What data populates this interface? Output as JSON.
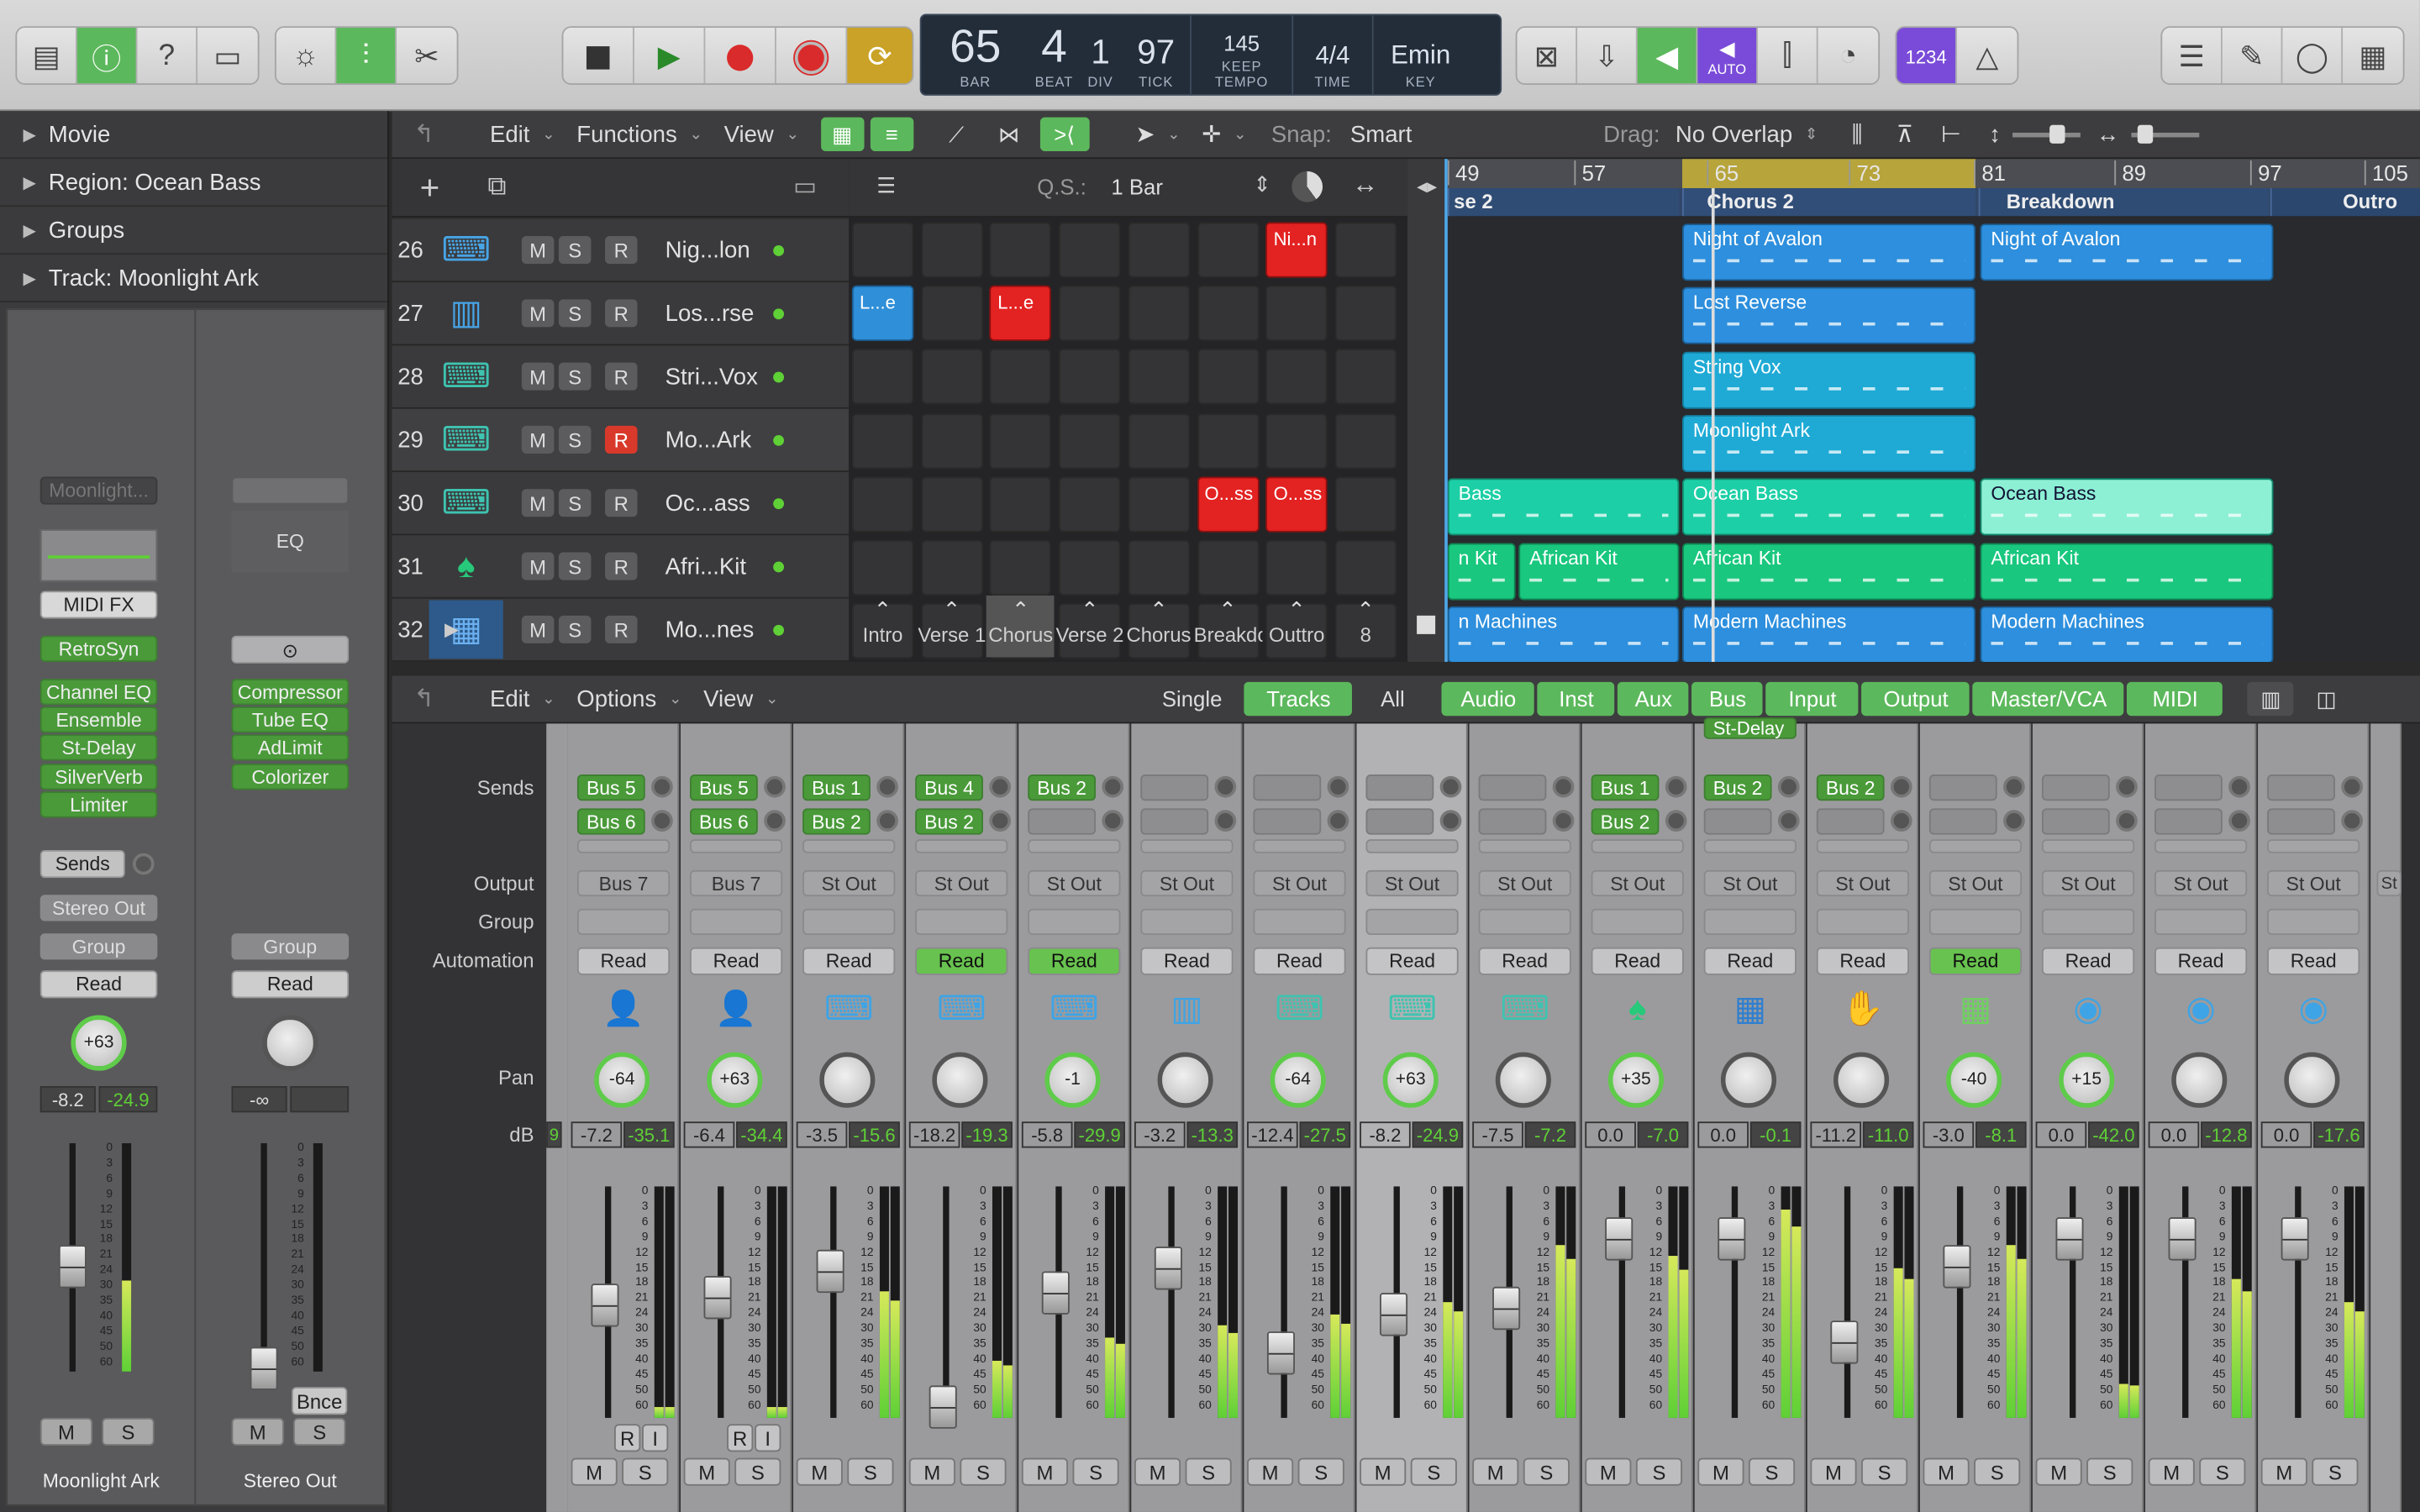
{
  "toolbar": {
    "lcd": {
      "bar": "65",
      "beat": "4",
      "div": "1",
      "tick": "97",
      "tempo": "145",
      "tempo_mode": "KEEP",
      "signature": "4/4",
      "key": "Emin",
      "bar_label": "BAR",
      "beat_label": "BEAT",
      "div_label": "DIV",
      "tick_label": "TICK",
      "tempo_label": "TEMPO",
      "time_label": "TIME",
      "key_label": "KEY"
    },
    "auto_label": "AUTO",
    "count_label": "1234"
  },
  "inspector": {
    "rows": [
      "Movie",
      "Region: Ocean Bass",
      "Groups",
      "Track: Moonlight Ark"
    ],
    "strip1": {
      "setting": "Moonlight...",
      "midi_fx": "MIDI FX",
      "instrument": "RetroSyn",
      "plugins": [
        "Channel EQ",
        "Ensemble",
        "St-Delay",
        "SilverVerb",
        "Limiter"
      ],
      "sends": "Sends",
      "output": "Stereo Out",
      "group": "Group",
      "automation": "Read",
      "pan": "+63",
      "db_vol": "-8.2",
      "db_peak": "-24.9",
      "mute": "M",
      "solo": "S",
      "name": "Moonlight Ark"
    },
    "strip2": {
      "eq_label": "EQ",
      "plugins": [
        "Compressor",
        "Tube EQ",
        "AdLimit",
        "Colorizer"
      ],
      "group": "Group",
      "automation": "Read",
      "db_vol": "-∞",
      "mute": "M",
      "solo": "S",
      "bounce": "Bnce",
      "name": "Stereo Out"
    },
    "scale": [
      "0",
      "3",
      "6",
      "9",
      "12",
      "15",
      "18",
      "21",
      "24",
      "30",
      "35",
      "40",
      "45",
      "50",
      "60"
    ]
  },
  "tracks_bar": {
    "edit": "Edit",
    "functions": "Functions",
    "view": "View",
    "snap_label": "Snap:",
    "snap_value": "Smart",
    "drag_label": "Drag:",
    "drag_value": "No Overlap"
  },
  "live_bar": {
    "qs_label": "Q.S.:",
    "qs_value": "1 Bar"
  },
  "tracks": [
    {
      "num": "26",
      "name": "Nig...lon",
      "mute": "M",
      "solo": "S",
      "rec": "R"
    },
    {
      "num": "27",
      "name": "Los...rse",
      "mute": "M",
      "solo": "S",
      "rec": "R"
    },
    {
      "num": "28",
      "name": "Stri...Vox",
      "mute": "M",
      "solo": "S",
      "rec": "R"
    },
    {
      "num": "29",
      "name": "Mo...Ark",
      "mute": "M",
      "solo": "S",
      "rec": "R"
    },
    {
      "num": "30",
      "name": "Oc...ass",
      "mute": "M",
      "solo": "S",
      "rec": "R"
    },
    {
      "num": "31",
      "name": "Afri...Kit",
      "mute": "M",
      "solo": "S",
      "rec": "R"
    },
    {
      "num": "32",
      "name": "Mo...nes",
      "mute": "M",
      "solo": "S",
      "rec": "R"
    }
  ],
  "live_clips": [
    {
      "label": "Ni...n"
    },
    {
      "label": "L...e"
    },
    {
      "label": "L...e"
    },
    {
      "label": "O...ss"
    },
    {
      "label": "O...ss"
    }
  ],
  "scenes": [
    "Intro",
    "Verse 1",
    "Chorus",
    "Verse 2",
    "Chorus",
    "Breakdo",
    "Outtro",
    "8"
  ],
  "ruler": [
    "49",
    "57",
    "65",
    "73",
    "81",
    "89",
    "97",
    "105"
  ],
  "markers": [
    "se 2",
    "Chorus 2",
    "Breakdown",
    "Outro"
  ],
  "regions": [
    {
      "label": "Night of Avalon"
    },
    {
      "label": "Night of Avalon"
    },
    {
      "label": "Lost Reverse"
    },
    {
      "label": "String Vox"
    },
    {
      "label": "Moonlight Ark"
    },
    {
      "label": "Bass"
    },
    {
      "label": "Ocean Bass"
    },
    {
      "label": "Ocean Bass"
    },
    {
      "label": "n Kit"
    },
    {
      "label": "African Kit"
    },
    {
      "label": "African Kit"
    },
    {
      "label": "African Kit"
    },
    {
      "label": "n Machines"
    },
    {
      "label": "Modern Machines"
    },
    {
      "label": "Modern Machines"
    }
  ],
  "mixer_bar": {
    "edit": "Edit",
    "options": "Options",
    "view": "View",
    "single": "Single",
    "tracks": "Tracks",
    "all": "All",
    "filters": [
      "Audio",
      "Inst",
      "Aux",
      "Bus",
      "Input",
      "Output",
      "Master/VCA",
      "MIDI"
    ]
  },
  "mixer_labels": {
    "sends": "Sends",
    "output": "Output",
    "group": "Group",
    "automation": "Automation",
    "pan": "Pan",
    "db": "dB"
  },
  "mixer_extra": {
    "first_db": "9",
    "first_ri_r": "R",
    "first_ri_i": "I",
    "stray_send": "St-Delay",
    "last_out": "St"
  },
  "strips": [
    {
      "send1": "Bus 5",
      "send2": "Bus 6",
      "output": "Bus 7",
      "automation": "Read",
      "auto_on": false,
      "pan": "-64",
      "db": "-7.2",
      "peak": "-35.1",
      "level": 0.05,
      "ri": true
    },
    {
      "send1": "Bus 5",
      "send2": "Bus 6",
      "output": "Bus 7",
      "automation": "Read",
      "auto_on": false,
      "pan": "+63",
      "db": "-6.4",
      "peak": "-34.4",
      "level": 0.05,
      "ri": true
    },
    {
      "send1": "Bus 1",
      "send2": "Bus 2",
      "output": "St Out",
      "automation": "Read",
      "auto_on": false,
      "pan": "",
      "db": "-3.5",
      "peak": "-15.6",
      "level": 0.55
    },
    {
      "send1": "Bus 4",
      "send2": "Bus 2",
      "output": "St Out",
      "automation": "Read",
      "auto_on": true,
      "pan": "",
      "db": "-18.2",
      "peak": "-19.3",
      "level": 0.25
    },
    {
      "send1": "Bus 2",
      "send2": "",
      "output": "St Out",
      "automation": "Read",
      "auto_on": true,
      "pan": "-1",
      "db": "-5.8",
      "peak": "-29.9",
      "level": 0.35
    },
    {
      "send1": "",
      "send2": "",
      "output": "St Out",
      "automation": "Read",
      "auto_on": false,
      "pan": "",
      "db": "-3.2",
      "peak": "-13.3",
      "level": 0.4
    },
    {
      "send1": "",
      "send2": "",
      "output": "St Out",
      "automation": "Read",
      "auto_on": false,
      "pan": "-64",
      "db": "-12.4",
      "peak": "-27.5",
      "level": 0.45
    },
    {
      "send1": "",
      "send2": "",
      "output": "St Out",
      "automation": "Read",
      "auto_on": false,
      "pan": "+63",
      "db": "-8.2",
      "peak": "-24.9",
      "level": 0.5
    },
    {
      "send1": "",
      "send2": "",
      "output": "St Out",
      "automation": "Read",
      "auto_on": false,
      "pan": "",
      "db": "-7.5",
      "peak": "-7.2",
      "level": 0.75
    },
    {
      "send1": "Bus 1",
      "send2": "Bus 2",
      "output": "St Out",
      "automation": "Read",
      "auto_on": false,
      "pan": "+35",
      "db": "0.0",
      "peak": "-7.0",
      "level": 0.7
    },
    {
      "send1": "Bus 2",
      "send2": "",
      "output": "St Out",
      "automation": "Read",
      "auto_on": false,
      "pan": "",
      "db": "0.0",
      "peak": "-0.1",
      "level": 0.9
    },
    {
      "send1": "Bus 2",
      "send2": "",
      "output": "St Out",
      "automation": "Read",
      "auto_on": false,
      "pan": "",
      "db": "-11.2",
      "peak": "-11.0",
      "level": 0.65
    },
    {
      "send1": "",
      "send2": "",
      "output": "St Out",
      "automation": "Read",
      "auto_on": true,
      "pan": "-40",
      "db": "-3.0",
      "peak": "-8.1",
      "level": 0.75
    },
    {
      "send1": "",
      "send2": "",
      "output": "St Out",
      "automation": "Read",
      "auto_on": false,
      "pan": "+15",
      "db": "0.0",
      "peak": "-42.0",
      "level": 0.15
    },
    {
      "send1": "",
      "send2": "",
      "output": "St Out",
      "automation": "Read",
      "auto_on": false,
      "pan": "",
      "db": "0.0",
      "peak": "-12.8",
      "level": 0.6
    },
    {
      "send1": "",
      "send2": "",
      "output": "St Out",
      "automation": "Read",
      "auto_on": false,
      "pan": "",
      "db": "0.0",
      "peak": "-17.6",
      "level": 0.5
    }
  ],
  "colors": {
    "green": "#5cb85c",
    "red": "#e32222",
    "blue": "#2d8fdd",
    "cyan": "#1faad6",
    "teal": "#1dcfa6",
    "mint": "#19c77e",
    "purple": "#7a4bd8",
    "gold": "#c9a227",
    "lcd": "#232d3a"
  }
}
